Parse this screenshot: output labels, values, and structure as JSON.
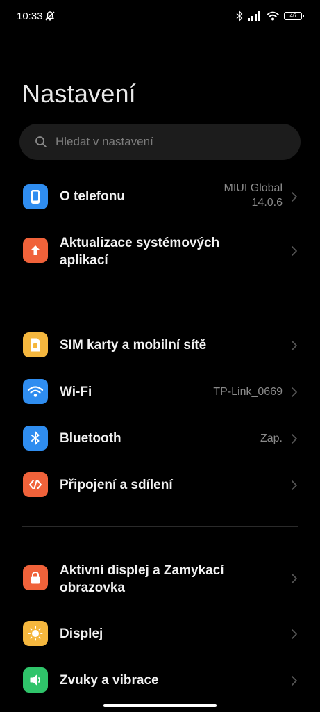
{
  "status_bar": {
    "time": "10:33",
    "battery": "46"
  },
  "page_title": "Nastavení",
  "search": {
    "placeholder": "Hledat v nastavení"
  },
  "items": [
    {
      "label": "O telefonu",
      "value": "MIUI Global\n14.0.6",
      "icon": "phone-icon",
      "color": "#2f8df0"
    },
    {
      "label": "Aktualizace systémových aplikací",
      "value": "",
      "icon": "arrow-up-icon",
      "color": "#f0623a"
    },
    {
      "label": "SIM karty a mobilní sítě",
      "value": "",
      "icon": "sim-card-icon",
      "color": "#f5b73e"
    },
    {
      "label": "Wi-Fi",
      "value": "TP-Link_0669",
      "icon": "wifi-icon",
      "color": "#2f8df0"
    },
    {
      "label": "Bluetooth",
      "value": "Zap.",
      "icon": "bluetooth-icon",
      "color": "#2f8df0"
    },
    {
      "label": "Připojení a sdílení",
      "value": "",
      "icon": "connection-sharing-icon",
      "color": "#f0623a"
    },
    {
      "label": "Aktivní displej a Zamykací obrazovka",
      "value": "",
      "icon": "lock-icon",
      "color": "#f0623a"
    },
    {
      "label": "Displej",
      "value": "",
      "icon": "sun-icon",
      "color": "#f5b73e"
    },
    {
      "label": "Zvuky a vibrace",
      "value": "",
      "icon": "speaker-icon",
      "color": "#2fc46a"
    }
  ]
}
